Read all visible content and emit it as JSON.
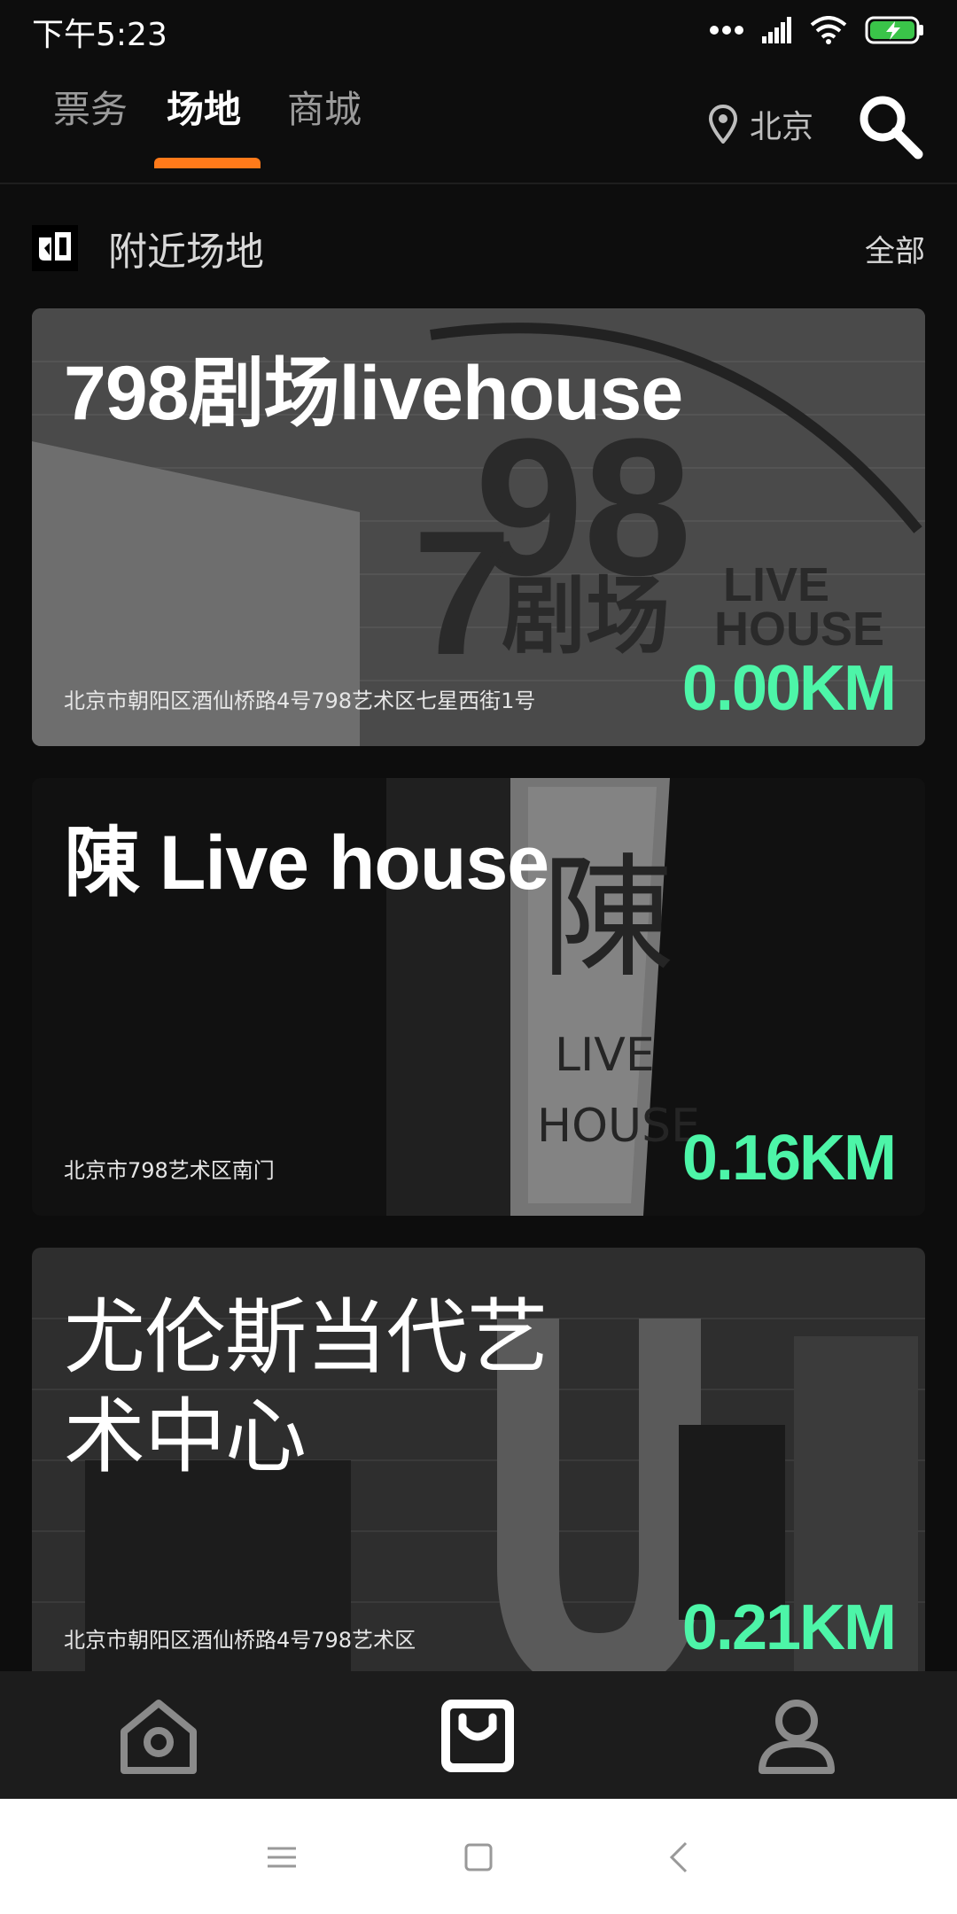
{
  "status": {
    "time": "下午5:23"
  },
  "nav": {
    "tabs": [
      {
        "label": "票务"
      },
      {
        "label": "场地"
      },
      {
        "label": "商城"
      }
    ],
    "location": "北京",
    "accent_color": "#ff7a1a"
  },
  "section": {
    "title": "附近场地",
    "all": "全部"
  },
  "venues": [
    {
      "name": "798剧场livehouse",
      "address": "北京市朝阳区酒仙桥路4号798艺术区七星西街1号",
      "distance": "0.00KM"
    },
    {
      "name": "陳 Live house",
      "address": "北京市798艺术区南门",
      "distance": "0.16KM"
    },
    {
      "name": "尤伦斯当代艺术中心",
      "address": "北京市朝阳区酒仙桥路4号798艺术区",
      "distance": "0.21KM"
    }
  ],
  "colors": {
    "distance": "#4df5a8",
    "background": "#0d0d0d"
  },
  "bottom_nav": [
    {
      "icon": "home-icon"
    },
    {
      "icon": "bag-icon"
    },
    {
      "icon": "profile-icon"
    }
  ]
}
